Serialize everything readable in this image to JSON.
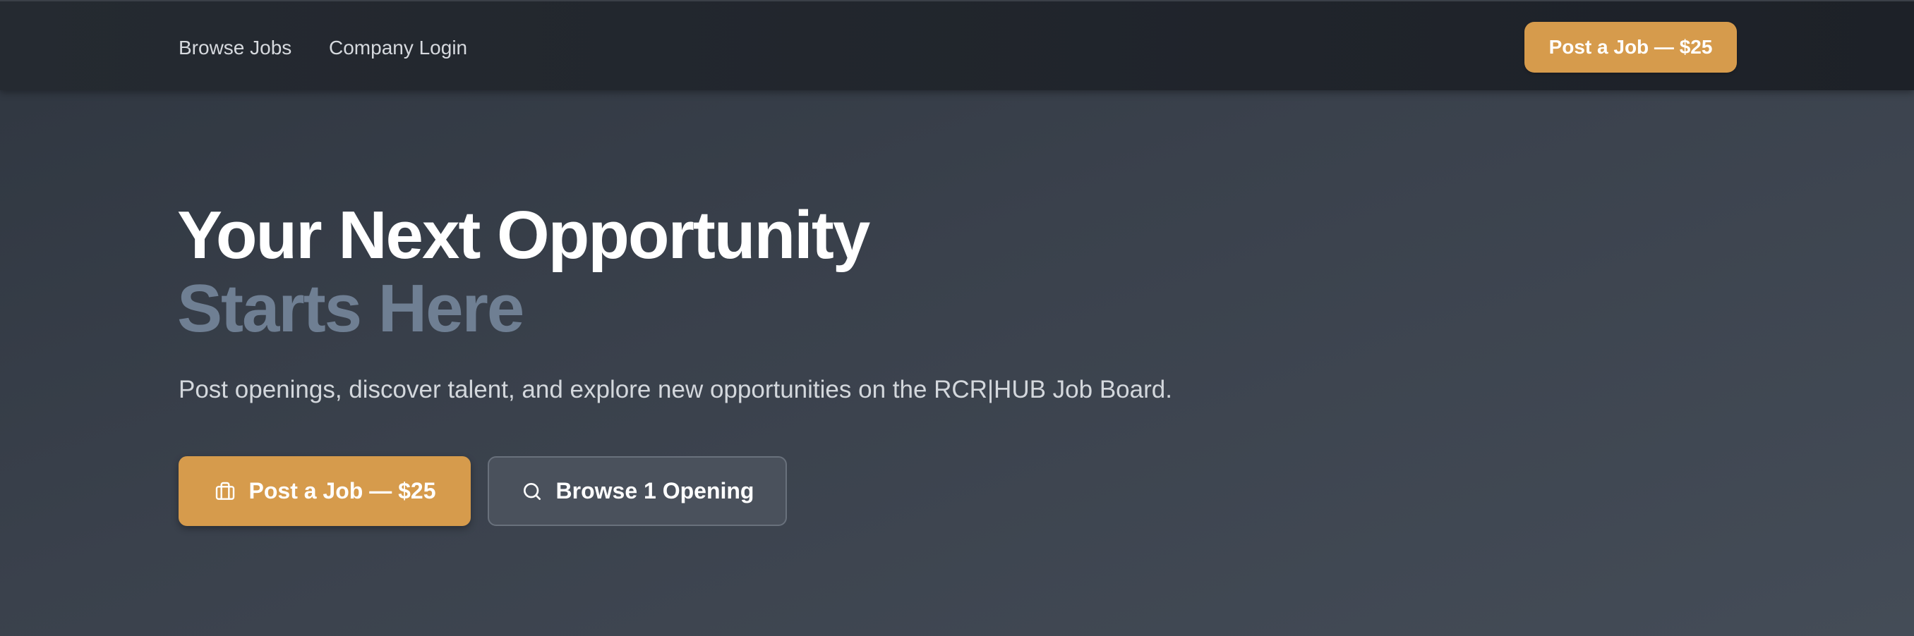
{
  "nav": {
    "browse_jobs": "Browse Jobs",
    "company_login": "Company Login",
    "post_job_cta": "Post a Job — $25"
  },
  "hero": {
    "title_line1": "Your Next Opportunity",
    "title_line2": "Starts Here",
    "subtitle": "Post openings, discover talent, and explore new opportunities on the RCR|HUB Job Board.",
    "primary_button": {
      "label": "Post a Job — $25",
      "icon": "briefcase-icon"
    },
    "secondary_button": {
      "label": "Browse 1 Opening",
      "icon": "search-icon"
    }
  },
  "colors": {
    "accent": "#d69b4c",
    "title_highlight": "#6f7f93",
    "nav_background": "#1f242b",
    "hero_background": "#3a414c"
  }
}
